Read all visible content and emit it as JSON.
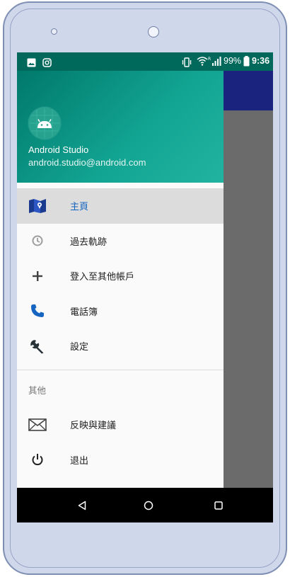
{
  "status_bar": {
    "battery": "99%",
    "time": "9:36",
    "icons": [
      "image-icon",
      "instagram-icon",
      "vibrate-icon",
      "wifi-icon",
      "signal-icon",
      "battery-icon"
    ]
  },
  "drawer": {
    "user_name": "Android Studio",
    "user_email": "android.studio@android.com",
    "menu": [
      {
        "label": "主頁",
        "icon": "map-icon",
        "selected": true
      },
      {
        "label": "過去軌跡",
        "icon": "history-icon",
        "selected": false
      },
      {
        "label": "登入至其他帳戶",
        "icon": "plus-icon",
        "selected": false
      },
      {
        "label": "電話簿",
        "icon": "phone-icon",
        "selected": false
      },
      {
        "label": "設定",
        "icon": "wrench-icon",
        "selected": false
      }
    ],
    "section_label": "其他",
    "secondary_menu": [
      {
        "label": "反映與建議",
        "icon": "mail-icon"
      },
      {
        "label": "退出",
        "icon": "power-icon"
      }
    ]
  },
  "nav_bar": {
    "buttons": [
      "back-icon",
      "home-icon",
      "recents-icon"
    ]
  },
  "colors": {
    "status_bar": "#00695c",
    "header_gradient_start": "#00796b",
    "header_gradient_end": "#22b3a0",
    "toolbar_behind": "#1a237e",
    "scrim": "#6b6b6b",
    "selected_label": "#1565c0"
  }
}
